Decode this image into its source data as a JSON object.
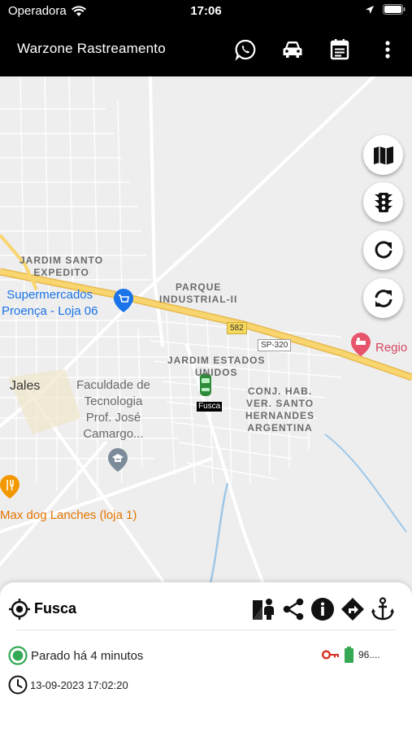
{
  "status_bar": {
    "carrier": "Operadora",
    "time": "17:06"
  },
  "app_bar": {
    "title": "Warzone Rastreamento",
    "actions": [
      "whatsapp-icon",
      "car-icon",
      "calendar-icon",
      "more-vert-icon"
    ]
  },
  "map": {
    "place_labels": {
      "jardim_santo": "JARDIM SANTO\nEXPEDITO",
      "parque_industrial": "PARQUE\nINDUSTRIAL-II",
      "jardim_estados": "JARDIM ESTADOS\nUNIDOS",
      "conj_hab": "CONJ. HAB.\nVER. SANTO\nHERNANDES\nARGENTINA"
    },
    "pois": {
      "supermercado": "Supermercados\nProença - Loja 06",
      "faculdade": "Faculdade de\nTecnologia\nProf. José\nCamargo...",
      "max_dog": "Max dog Lanches (loja 1)",
      "regional": "Regio",
      "city": "Jales"
    },
    "shields": {
      "road_582": "582",
      "sp320": "SP-320"
    },
    "vehicle_marker_label": "Fusca",
    "fab_buttons": [
      "map-icon",
      "traffic-light-icon",
      "refresh-icon",
      "sync-icon"
    ],
    "colors": {
      "highway": "#f8d56f",
      "road": "#ffffff",
      "water": "#9ec7e8",
      "accent_blue": "#1a73e8",
      "poi_orange": "#f29900",
      "poi_pink": "#e8546b"
    }
  },
  "vehicle_panel": {
    "name": "Fusca",
    "status": "Parado há 4 minutos",
    "datetime": "13-09-2023 17:02:20",
    "battery_value": "96....",
    "status_color": "#34a853",
    "ignition_color": "#d93025",
    "actions": [
      "street-view-icon",
      "share-icon",
      "info-icon",
      "directions-icon",
      "anchor-icon"
    ]
  }
}
